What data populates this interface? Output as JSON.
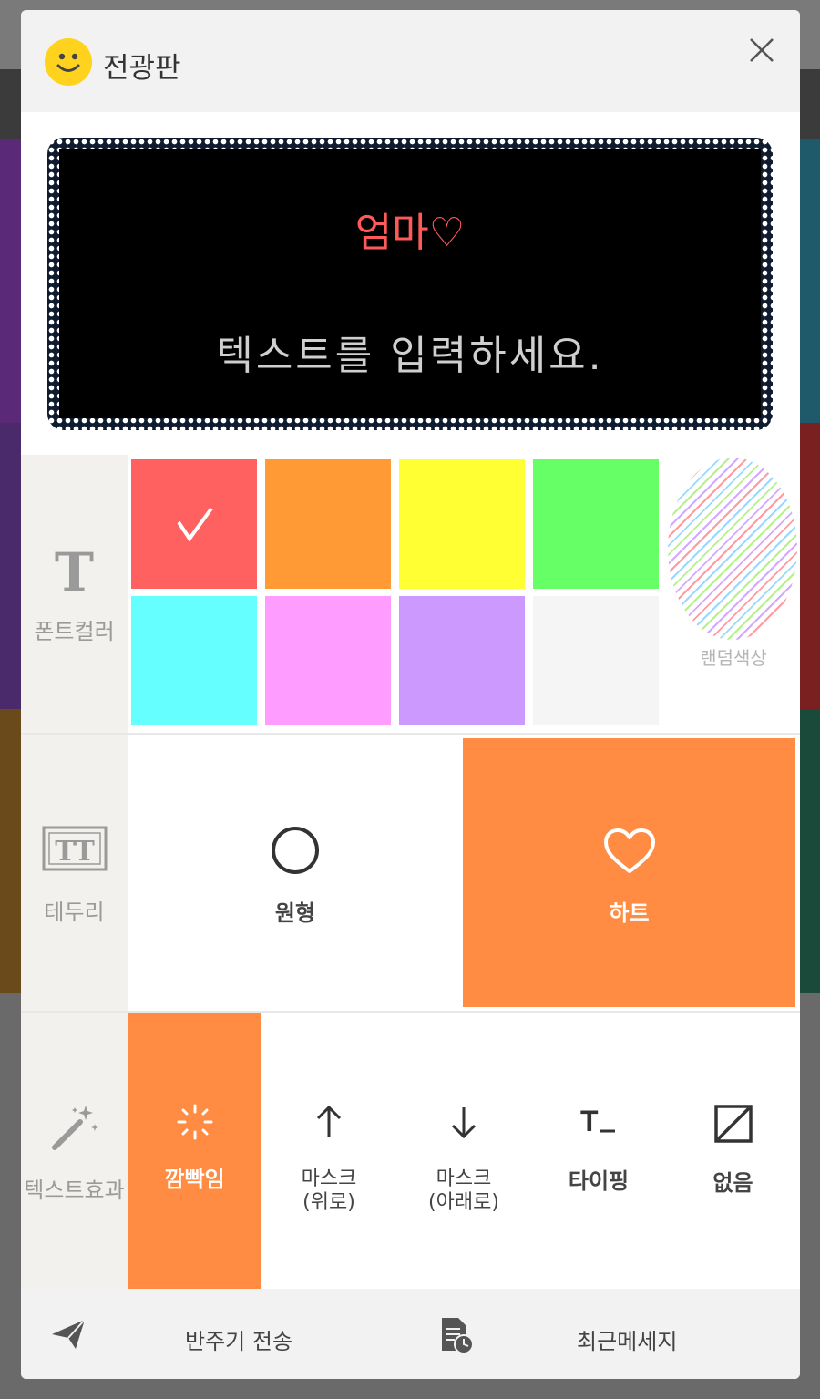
{
  "dialog": {
    "title": "전광판",
    "close_icon": "close-icon"
  },
  "board": {
    "line1": "엄마♡",
    "line2": "텍스트를 입력하세요.",
    "frame_style": "heart-border"
  },
  "font_color": {
    "label": "폰트컬러",
    "selected": "#ff6060",
    "swatches": [
      "#ff6060",
      "#ff9a35",
      "#ffff33",
      "#66ff66",
      "#66ffff",
      "#ff9cff",
      "#cc99ff",
      "#f5f5f5"
    ],
    "random_label": "랜덤색상"
  },
  "border": {
    "label": "테두리",
    "options": [
      {
        "label": "원형",
        "icon": "circle-icon",
        "selected": false
      },
      {
        "label": "하트",
        "icon": "heart-icon",
        "selected": true
      }
    ]
  },
  "text_effect": {
    "label": "텍스트효과",
    "options": [
      {
        "label": "깜빡임",
        "icon": "sparkle-icon",
        "selected": true
      },
      {
        "label": "마스크\n(위로)",
        "icon": "arrow-up-icon",
        "selected": false
      },
      {
        "label": "마스크\n(아래로)",
        "icon": "arrow-down-icon",
        "selected": false
      },
      {
        "label": "타이핑",
        "icon": "typing-icon",
        "selected": false
      },
      {
        "label": "없음",
        "icon": "none-icon",
        "selected": false
      }
    ]
  },
  "footer": {
    "send_label": "반주기 전송",
    "recent_label": "최근메세지"
  },
  "colors": {
    "accent": "#ff8c42"
  }
}
